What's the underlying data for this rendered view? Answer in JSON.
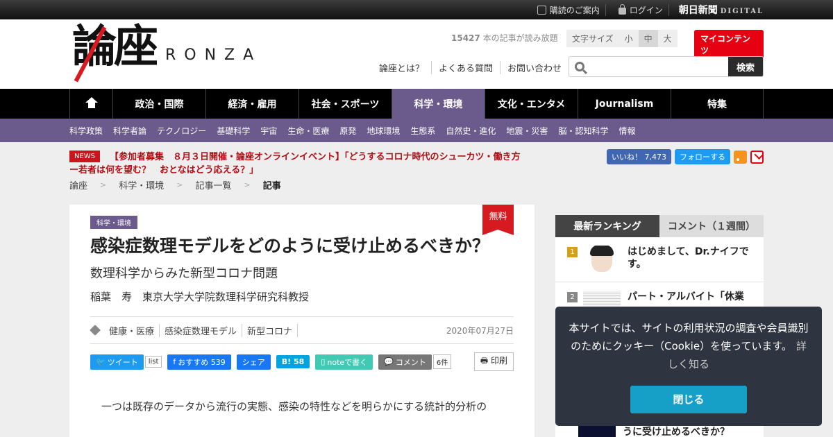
{
  "topbar": {
    "subscribe": "購読のご案内",
    "login": "ログイン",
    "brand": "朝日新聞",
    "brand_sub": "DIGITAL"
  },
  "header": {
    "logo_kanji": "論座",
    "logo_roman": "RONZA",
    "read_count_number": "15427",
    "read_count_text": "本の記事が読み放題",
    "fontsize_label": "文字サイズ",
    "fontsize_small": "小",
    "fontsize_medium": "中",
    "fontsize_large": "大",
    "mycontents": "マイコンテンツ",
    "links": [
      "論座とは？",
      "よくある質問",
      "お問い合わせ"
    ],
    "search_placeholder": "",
    "search_button": "検索"
  },
  "mainnav": {
    "items": [
      "政治・国際",
      "経済・雇用",
      "社会・スポーツ",
      "科学・環境",
      "文化・エンタメ",
      "Journalism",
      "特集"
    ]
  },
  "subnav": {
    "items": [
      "科学政策",
      "科学者論",
      "テクノロジー",
      "基礎科学",
      "宇宙",
      "生命・医療",
      "原発",
      "地球環境",
      "生態系",
      "自然史・進化",
      "地震・災害",
      "脳・認知科学",
      "情報"
    ]
  },
  "news": {
    "label": "NEWS",
    "text": "【参加者募集　８月３日開催・論座オンラインイベント】「どうするコロナ時代のシューカツ・働き方ー若者は何を望む？　おとなはどう応える？」"
  },
  "social": {
    "fb_like": "いいね！ 7,473",
    "tw_follow": "フォローする"
  },
  "breadcrumb": [
    "論座",
    "科学・環境",
    "記事一覧",
    "記事"
  ],
  "article": {
    "category": "科学・環境",
    "free": "無料",
    "title": "感染症数理モデルをどのように受け止めるべきか？",
    "subtitle": "数理科学からみた新型コロナ問題",
    "author": "稲葉　寿　東京大学大学院数理科学研究科教授",
    "tags": [
      "健康・医療",
      "感染症数理モデル",
      "新型コロナ"
    ],
    "date": "2020年07月27日",
    "share": {
      "tweet": "ツイート",
      "list": "list",
      "fb_recommend": "おすすめ 539",
      "fb_share": "シェア",
      "hatena": "B! 58",
      "note": "noteで書く",
      "comment": "コメント",
      "comment_count": "6件",
      "print": "印刷"
    },
    "body_first_line": "一つは既存のデータから流行の実態、感染の特性などを明らかにする統計的分析の"
  },
  "sidebar": {
    "tab_ranking": "最新ランキング",
    "tab_comment": "コメント（１週間）",
    "ranking": [
      {
        "num": "1",
        "title": "はじめまして、Dr.ナイフです。"
      },
      {
        "num": "2",
        "title": "パート・アルバイト「休業"
      }
    ],
    "bottom_title": "うに受け止めるべきか？"
  },
  "cookie": {
    "text": "本サイトでは、サイトの利用状況の調査や会員識別のためにクッキー（Cookie）を使っています。",
    "more": "詳しく知る",
    "close": "閉じる"
  }
}
